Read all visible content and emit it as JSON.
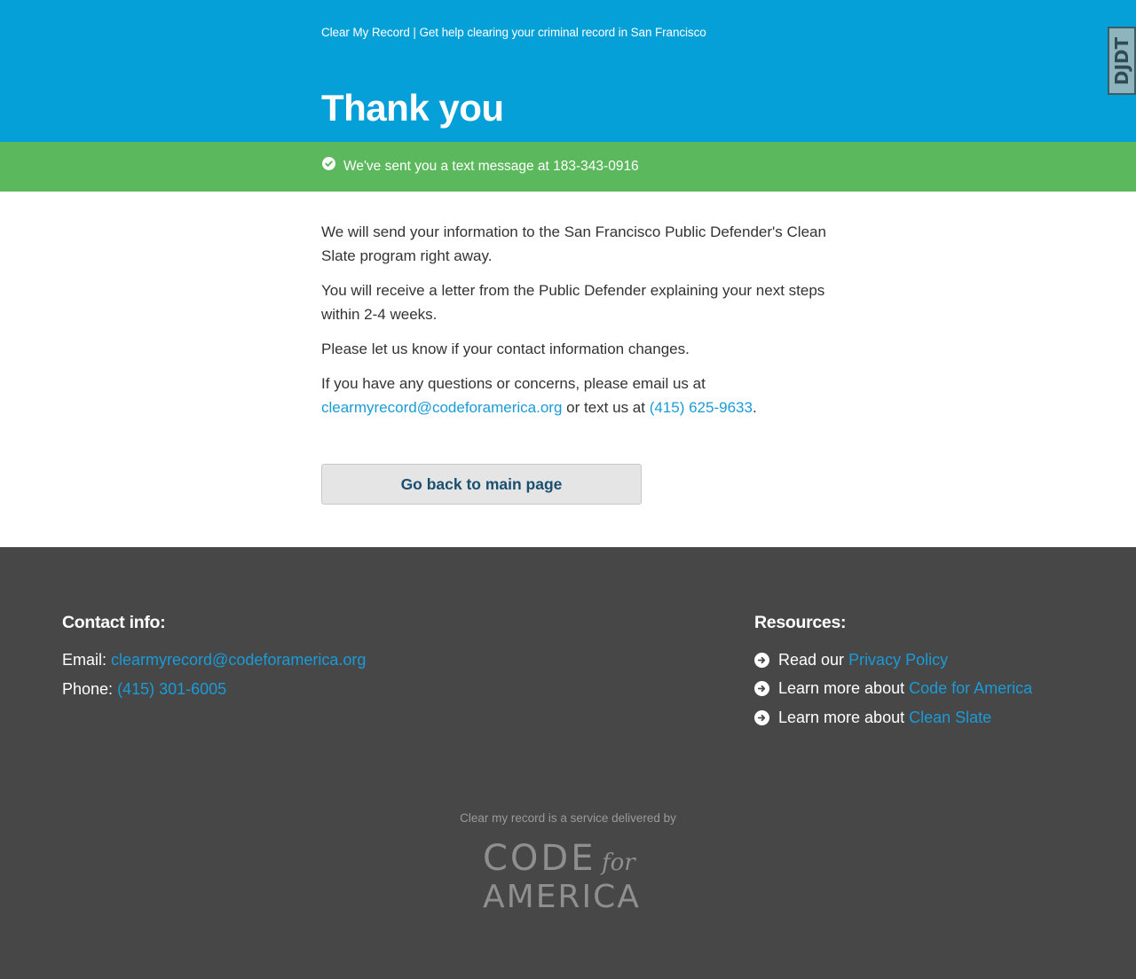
{
  "header": {
    "site_title": "Clear My Record | Get help clearing your criminal record in San Francisco",
    "page_title": "Thank you",
    "debug_badge": "DJDT"
  },
  "notice": {
    "icon": "check-circle-icon",
    "text": "We've sent you a text message at 183-343-0916"
  },
  "main": {
    "p1": "We will send your information to the San Francisco Public Defender's Clean Slate program right away.",
    "p2": "You will receive a letter from the Public Defender explaining your next steps within 2-4 weeks.",
    "p3": "Please let us know if your contact information changes.",
    "p4_intro": "If you have any questions or concerns, please email us at",
    "p4_email": "clearmyrecord@codeforamerica.org",
    "p4_mid": " or text us at ",
    "p4_phone": "(415) 625-9633",
    "p4_end": ".",
    "back_button": "Go back to main page"
  },
  "footer": {
    "contact_heading": "Contact info:",
    "email_label": "Email: ",
    "email_value": "clearmyrecord@codeforamerica.org",
    "phone_label": "Phone: ",
    "phone_value": "(415) 301-6005",
    "resources_heading": "Resources:",
    "resources": [
      {
        "prefix": "Read our",
        "link": "Privacy Policy"
      },
      {
        "prefix": "Learn more about",
        "link": "Code for America"
      },
      {
        "prefix": "Learn more about",
        "link": "Clean Slate"
      }
    ],
    "delivered_by": "Clear my record is a service delivered by",
    "logo_text": {
      "line1": "CODE",
      "for": "for",
      "line2": "AMERICA"
    }
  },
  "colors": {
    "header_bg": "#05a0d8",
    "notice_bg": "#5cb85c",
    "link": "#1a9bd7",
    "footer_bg": "#474747",
    "button_bg": "#e5e5e5",
    "button_text": "#1b4f6f"
  }
}
